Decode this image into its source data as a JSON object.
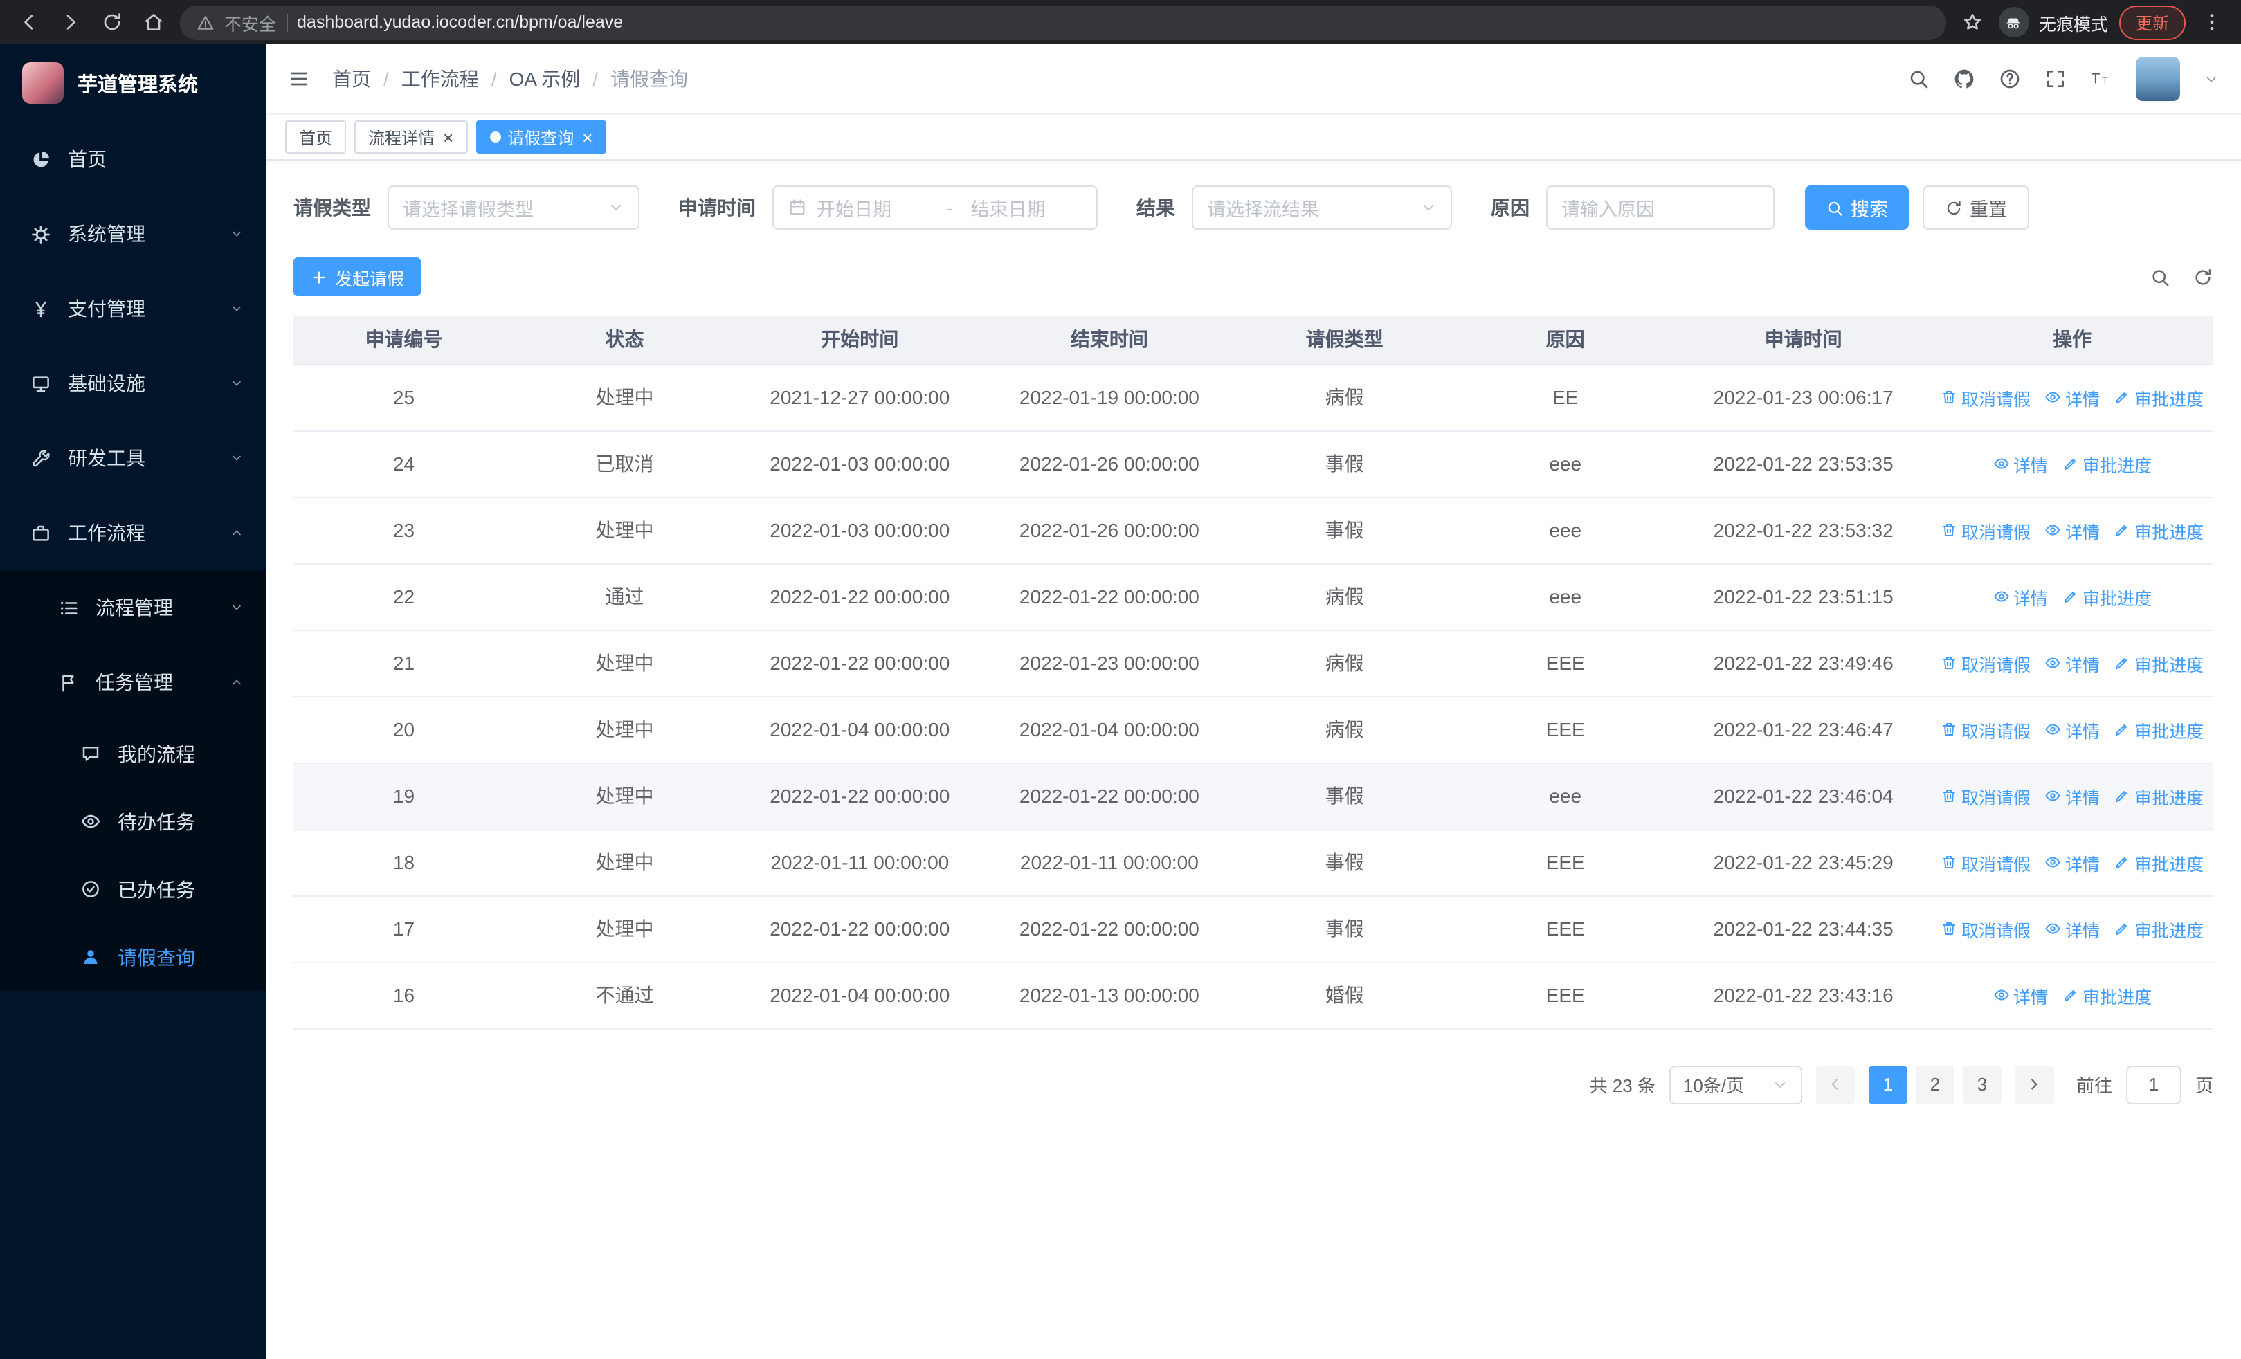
{
  "browser": {
    "security_label": "不安全",
    "url": "dashboard.yudao.iocoder.cn/bpm/oa/leave",
    "incognito_label": "无痕模式",
    "update_label": "更新"
  },
  "sidebar": {
    "logo_title": "芋道管理系统",
    "menu": [
      {
        "name": "home",
        "label": "首页",
        "icon": "dashboard",
        "level": 1,
        "arrow": "none",
        "active": false
      },
      {
        "name": "system-management",
        "label": "系统管理",
        "icon": "gear",
        "level": 1,
        "arrow": "down",
        "active": false
      },
      {
        "name": "payment-management",
        "label": "支付管理",
        "icon": "yen",
        "level": 1,
        "arrow": "down",
        "active": false
      },
      {
        "name": "infrastructure",
        "label": "基础设施",
        "icon": "infra",
        "level": 1,
        "arrow": "down",
        "active": false
      },
      {
        "name": "dev-tools",
        "label": "研发工具",
        "icon": "tools",
        "level": 1,
        "arrow": "down",
        "active": false
      },
      {
        "name": "workflow",
        "label": "工作流程",
        "icon": "workflow",
        "level": 1,
        "arrow": "up",
        "active": false
      },
      {
        "name": "process-management",
        "label": "流程管理",
        "icon": "process",
        "level": 2,
        "arrow": "down",
        "active": false
      },
      {
        "name": "task-management",
        "label": "任务管理",
        "icon": "task",
        "level": 2,
        "arrow": "up",
        "active": false
      },
      {
        "name": "my-process",
        "label": "我的流程",
        "icon": "chat",
        "level": 3,
        "arrow": "none",
        "active": false
      },
      {
        "name": "todo-tasks",
        "label": "待办任务",
        "icon": "eye",
        "level": 3,
        "arrow": "none",
        "active": false
      },
      {
        "name": "done-tasks",
        "label": "已办任务",
        "icon": "done",
        "level": 3,
        "arrow": "none",
        "active": false
      },
      {
        "name": "leave-query",
        "label": "请假查询",
        "icon": "user",
        "level": 3,
        "arrow": "none",
        "active": true
      }
    ]
  },
  "header": {
    "breadcrumb": [
      "首页",
      "工作流程",
      "OA 示例",
      "请假查询"
    ]
  },
  "tabs": [
    {
      "name": "home",
      "label": "首页",
      "closable": false,
      "active": false
    },
    {
      "name": "process-detail",
      "label": "流程详情",
      "closable": true,
      "active": false
    },
    {
      "name": "leave-query",
      "label": "请假查询",
      "closable": true,
      "active": true
    }
  ],
  "filters": {
    "leave_type_label": "请假类型",
    "leave_type_placeholder": "请选择请假类型",
    "apply_time_label": "申请时间",
    "start_date_placeholder": "开始日期",
    "range_separator": "-",
    "end_date_placeholder": "结束日期",
    "result_label": "结果",
    "result_placeholder": "请选择流结果",
    "reason_label": "原因",
    "reason_placeholder": "请输入原因",
    "search_button": "搜索",
    "reset_button": "重置"
  },
  "toolbar": {
    "create_label": "发起请假"
  },
  "table": {
    "columns": [
      "申请编号",
      "状态",
      "开始时间",
      "结束时间",
      "请假类型",
      "原因",
      "申请时间",
      "操作"
    ],
    "action_defs": {
      "cancel": {
        "label": "取消请假",
        "icon": "trash"
      },
      "detail": {
        "label": "详情",
        "icon": "eye"
      },
      "progress": {
        "label": "审批进度",
        "icon": "edit"
      }
    },
    "rows": [
      {
        "id": "25",
        "status": "处理中",
        "start": "2021-12-27 00:00:00",
        "end": "2022-01-19 00:00:00",
        "type": "病假",
        "reason": "EE",
        "apply_time": "2022-01-23 00:06:17",
        "actions": [
          "cancel",
          "detail",
          "progress"
        ],
        "highlighted": false
      },
      {
        "id": "24",
        "status": "已取消",
        "start": "2022-01-03 00:00:00",
        "end": "2022-01-26 00:00:00",
        "type": "事假",
        "reason": "eee",
        "apply_time": "2022-01-22 23:53:35",
        "actions": [
          "detail",
          "progress"
        ],
        "highlighted": false
      },
      {
        "id": "23",
        "status": "处理中",
        "start": "2022-01-03 00:00:00",
        "end": "2022-01-26 00:00:00",
        "type": "事假",
        "reason": "eee",
        "apply_time": "2022-01-22 23:53:32",
        "actions": [
          "cancel",
          "detail",
          "progress"
        ],
        "highlighted": false
      },
      {
        "id": "22",
        "status": "通过",
        "start": "2022-01-22 00:00:00",
        "end": "2022-01-22 00:00:00",
        "type": "病假",
        "reason": "eee",
        "apply_time": "2022-01-22 23:51:15",
        "actions": [
          "detail",
          "progress"
        ],
        "highlighted": false
      },
      {
        "id": "21",
        "status": "处理中",
        "start": "2022-01-22 00:00:00",
        "end": "2022-01-23 00:00:00",
        "type": "病假",
        "reason": "EEE",
        "apply_time": "2022-01-22 23:49:46",
        "actions": [
          "cancel",
          "detail",
          "progress"
        ],
        "highlighted": false
      },
      {
        "id": "20",
        "status": "处理中",
        "start": "2022-01-04 00:00:00",
        "end": "2022-01-04 00:00:00",
        "type": "病假",
        "reason": "EEE",
        "apply_time": "2022-01-22 23:46:47",
        "actions": [
          "cancel",
          "detail",
          "progress"
        ],
        "highlighted": false
      },
      {
        "id": "19",
        "status": "处理中",
        "start": "2022-01-22 00:00:00",
        "end": "2022-01-22 00:00:00",
        "type": "事假",
        "reason": "eee",
        "apply_time": "2022-01-22 23:46:04",
        "actions": [
          "cancel",
          "detail",
          "progress"
        ],
        "highlighted": true
      },
      {
        "id": "18",
        "status": "处理中",
        "start": "2022-01-11 00:00:00",
        "end": "2022-01-11 00:00:00",
        "type": "事假",
        "reason": "EEE",
        "apply_time": "2022-01-22 23:45:29",
        "actions": [
          "cancel",
          "detail",
          "progress"
        ],
        "highlighted": false
      },
      {
        "id": "17",
        "status": "处理中",
        "start": "2022-01-22 00:00:00",
        "end": "2022-01-22 00:00:00",
        "type": "事假",
        "reason": "EEE",
        "apply_time": "2022-01-22 23:44:35",
        "actions": [
          "cancel",
          "detail",
          "progress"
        ],
        "highlighted": false
      },
      {
        "id": "16",
        "status": "不通过",
        "start": "2022-01-04 00:00:00",
        "end": "2022-01-13 00:00:00",
        "type": "婚假",
        "reason": "EEE",
        "apply_time": "2022-01-22 23:43:16",
        "actions": [
          "detail",
          "progress"
        ],
        "highlighted": false
      }
    ]
  },
  "pagination": {
    "total_label": "共 23 条",
    "page_size_label": "10条/页",
    "pages": [
      "1",
      "2",
      "3"
    ],
    "active_page": "1",
    "goto_label": "前往",
    "goto_value": "1",
    "page_unit": "页"
  }
}
